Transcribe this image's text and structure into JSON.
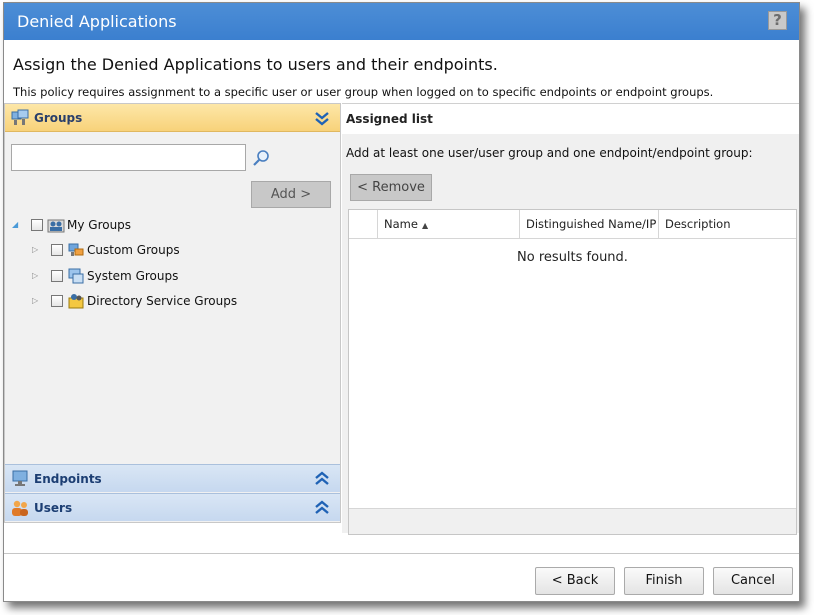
{
  "window": {
    "title": "Denied Applications",
    "help_label": "?"
  },
  "header": {
    "heading": "Assign the Denied Applications to users and their endpoints.",
    "subheading": "This policy requires assignment to a specific user or user group when logged on to specific endpoints or endpoint groups."
  },
  "left_panel": {
    "groups_label": "Groups",
    "search_value": "",
    "add_label": "Add >",
    "tree": {
      "root": "My Groups",
      "children": [
        "Custom Groups",
        "System Groups",
        "Directory Service Groups"
      ]
    },
    "endpoints_label": "Endpoints",
    "users_label": "Users"
  },
  "right_panel": {
    "title": "Assigned list",
    "hint": "Add at least one user/user group and one endpoint/endpoint group:",
    "remove_label": "< Remove",
    "columns": [
      "Name",
      "Distinguished Name/IP",
      "Description"
    ],
    "empty_message": "No results found."
  },
  "footer": {
    "back_label": "< Back",
    "finish_label": "Finish",
    "cancel_label": "Cancel"
  },
  "colors": {
    "titlebar": "#3b7fcf",
    "groups_header": "#f8d27a",
    "accordion_blue": "#c6d8ef",
    "chevron": "#1f62b5"
  }
}
